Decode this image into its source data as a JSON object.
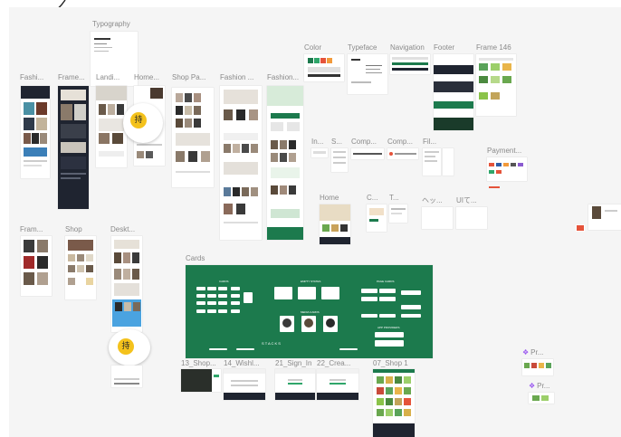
{
  "canvas": {
    "frames": {
      "typography": "Typography",
      "fashi": "Fashi...",
      "frame1": "Frame...",
      "landi": "Landi...",
      "home1": "Home...",
      "shop_pa": "Shop Pa...",
      "fashion1": "Fashion ...",
      "fashion2": "Fashion...",
      "color": "Color",
      "typeface": "Typeface",
      "navigation": "Navigation",
      "footer": "Footer",
      "frame146": "Frame 146",
      "in": "In...",
      "s": "S...",
      "comp1": "Comp...",
      "comp2": "Comp...",
      "fil": "Fil...",
      "payment": "Payment...",
      "home2": "Home",
      "c": "C...",
      "t": "T...",
      "jp1": "ヘッ...",
      "jp2": "UIて...",
      "fram2": "Fram...",
      "shop": "Shop",
      "deskt": "Deskt...",
      "cards": "Cards",
      "f13": "13_Shop...",
      "f14": "14_Wishl...",
      "f21": "21_Sign_In",
      "f22": "22_Crea...",
      "f07": "07_Shop 1"
    },
    "cards_board": {
      "cards": "CARDS",
      "empty_states": "EMPTY STATES",
      "page_cards": "PAGE CARDS",
      "media_cards": "MEDIA CARDS",
      "app_providers": "APP PROVIDERS",
      "stacks": "S T A C K S"
    },
    "plugins": [
      {
        "label": "Pr...",
        "icon": "plugin-icon"
      },
      {
        "label": "Pr...",
        "icon": "plugin-icon"
      }
    ],
    "avatar_glyph": "持",
    "colors": {
      "board": "#f5f5f5",
      "green": "#1c7a4d",
      "dark": "#1f2430",
      "accent_yellow": "#f4c21c",
      "plugin_purple": "#9b59f0"
    }
  }
}
